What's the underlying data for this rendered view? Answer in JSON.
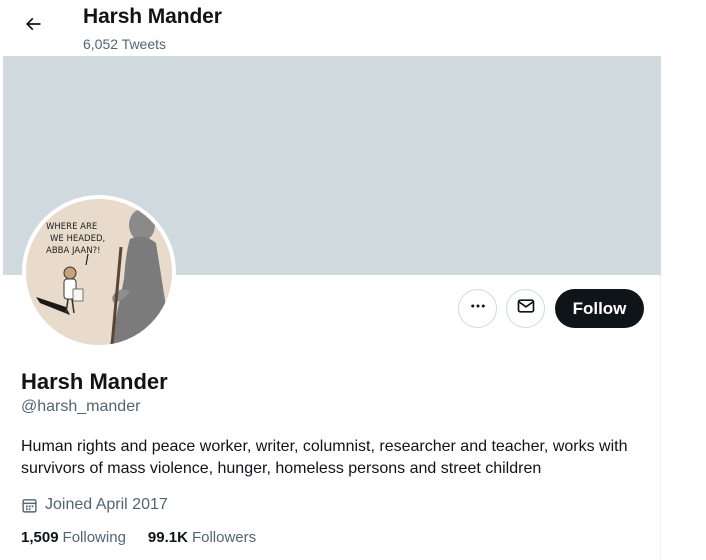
{
  "header": {
    "name": "Harsh Mander",
    "tweet_count": "6,052 Tweets"
  },
  "colors": {
    "banner": "#cfd9de",
    "follow_button_bg": "#0f1419",
    "secondary_text": "#536471"
  },
  "avatar": {
    "caption_lines": [
      "WHERE ARE",
      "WE HEADED,",
      "ABBA JAAN?!"
    ]
  },
  "actions": {
    "more_icon": "more-dots-icon",
    "message_icon": "envelope-icon",
    "follow_label": "Follow"
  },
  "profile": {
    "name": "Harsh Mander",
    "handle": "@harsh_mander",
    "bio": "Human rights and peace worker, writer, columnist, researcher and teacher, works with survivors of mass violence, hunger, homeless persons and street children",
    "joined": "Joined April 2017",
    "following_count": "1,509",
    "following_label": "Following",
    "followers_count": "99.1K",
    "followers_label": "Followers"
  }
}
